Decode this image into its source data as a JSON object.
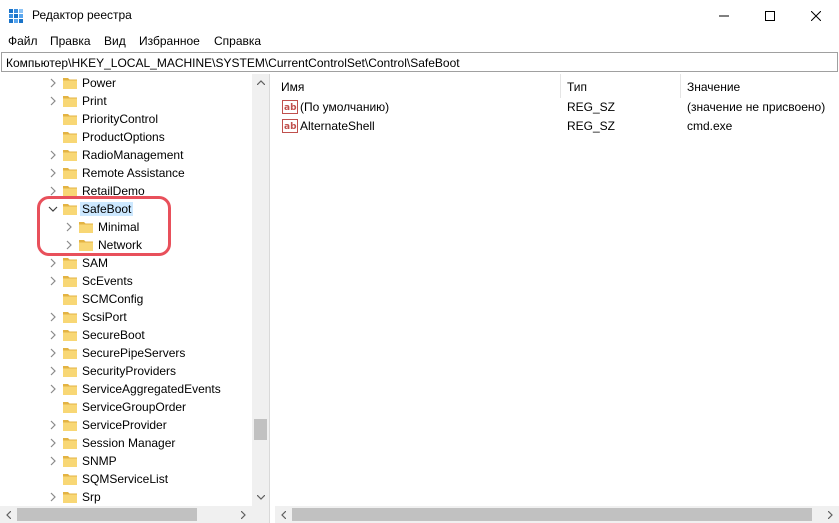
{
  "window": {
    "title": "Редактор реестра"
  },
  "menu": [
    "Файл",
    "Правка",
    "Вид",
    "Избранное",
    "Справка"
  ],
  "address": "Компьютер\\HKEY_LOCAL_MACHINE\\SYSTEM\\CurrentControlSet\\Control\\SafeBoot",
  "tree": {
    "items": [
      {
        "label": "Power",
        "level": 1,
        "expander": "collapsed"
      },
      {
        "label": "Print",
        "level": 1,
        "expander": "collapsed"
      },
      {
        "label": "PriorityControl",
        "level": 1,
        "expander": "none"
      },
      {
        "label": "ProductOptions",
        "level": 1,
        "expander": "none"
      },
      {
        "label": "RadioManagement",
        "level": 1,
        "expander": "collapsed"
      },
      {
        "label": "Remote Assistance",
        "level": 1,
        "expander": "collapsed"
      },
      {
        "label": "RetailDemo",
        "level": 1,
        "expander": "collapsed"
      },
      {
        "label": "SafeBoot",
        "level": 1,
        "expander": "expanded",
        "selected": true
      },
      {
        "label": "Minimal",
        "level": 2,
        "expander": "collapsed"
      },
      {
        "label": "Network",
        "level": 2,
        "expander": "collapsed"
      },
      {
        "label": "SAM",
        "level": 1,
        "expander": "collapsed"
      },
      {
        "label": "ScEvents",
        "level": 1,
        "expander": "collapsed"
      },
      {
        "label": "SCMConfig",
        "level": 1,
        "expander": "none"
      },
      {
        "label": "ScsiPort",
        "level": 1,
        "expander": "collapsed"
      },
      {
        "label": "SecureBoot",
        "level": 1,
        "expander": "collapsed"
      },
      {
        "label": "SecurePipeServers",
        "level": 1,
        "expander": "collapsed"
      },
      {
        "label": "SecurityProviders",
        "level": 1,
        "expander": "collapsed"
      },
      {
        "label": "ServiceAggregatedEvents",
        "level": 1,
        "expander": "collapsed"
      },
      {
        "label": "ServiceGroupOrder",
        "level": 1,
        "expander": "none"
      },
      {
        "label": "ServiceProvider",
        "level": 1,
        "expander": "collapsed"
      },
      {
        "label": "Session Manager",
        "level": 1,
        "expander": "collapsed"
      },
      {
        "label": "SNMP",
        "level": 1,
        "expander": "collapsed"
      },
      {
        "label": "SQMServiceList",
        "level": 1,
        "expander": "none"
      },
      {
        "label": "Srp",
        "level": 1,
        "expander": "collapsed"
      }
    ]
  },
  "list": {
    "columns": [
      "Имя",
      "Тип",
      "Значение"
    ],
    "rows": [
      {
        "name": "(По умолчанию)",
        "type": "REG_SZ",
        "value": "(значение не присвоено)"
      },
      {
        "name": "AlternateShell",
        "type": "REG_SZ",
        "value": "cmd.exe"
      }
    ]
  },
  "colors": {
    "selection": "#cce8ff",
    "highlight_ring": "#e8505b",
    "folder": "#f8d775",
    "folder_dark": "#e3b343"
  }
}
